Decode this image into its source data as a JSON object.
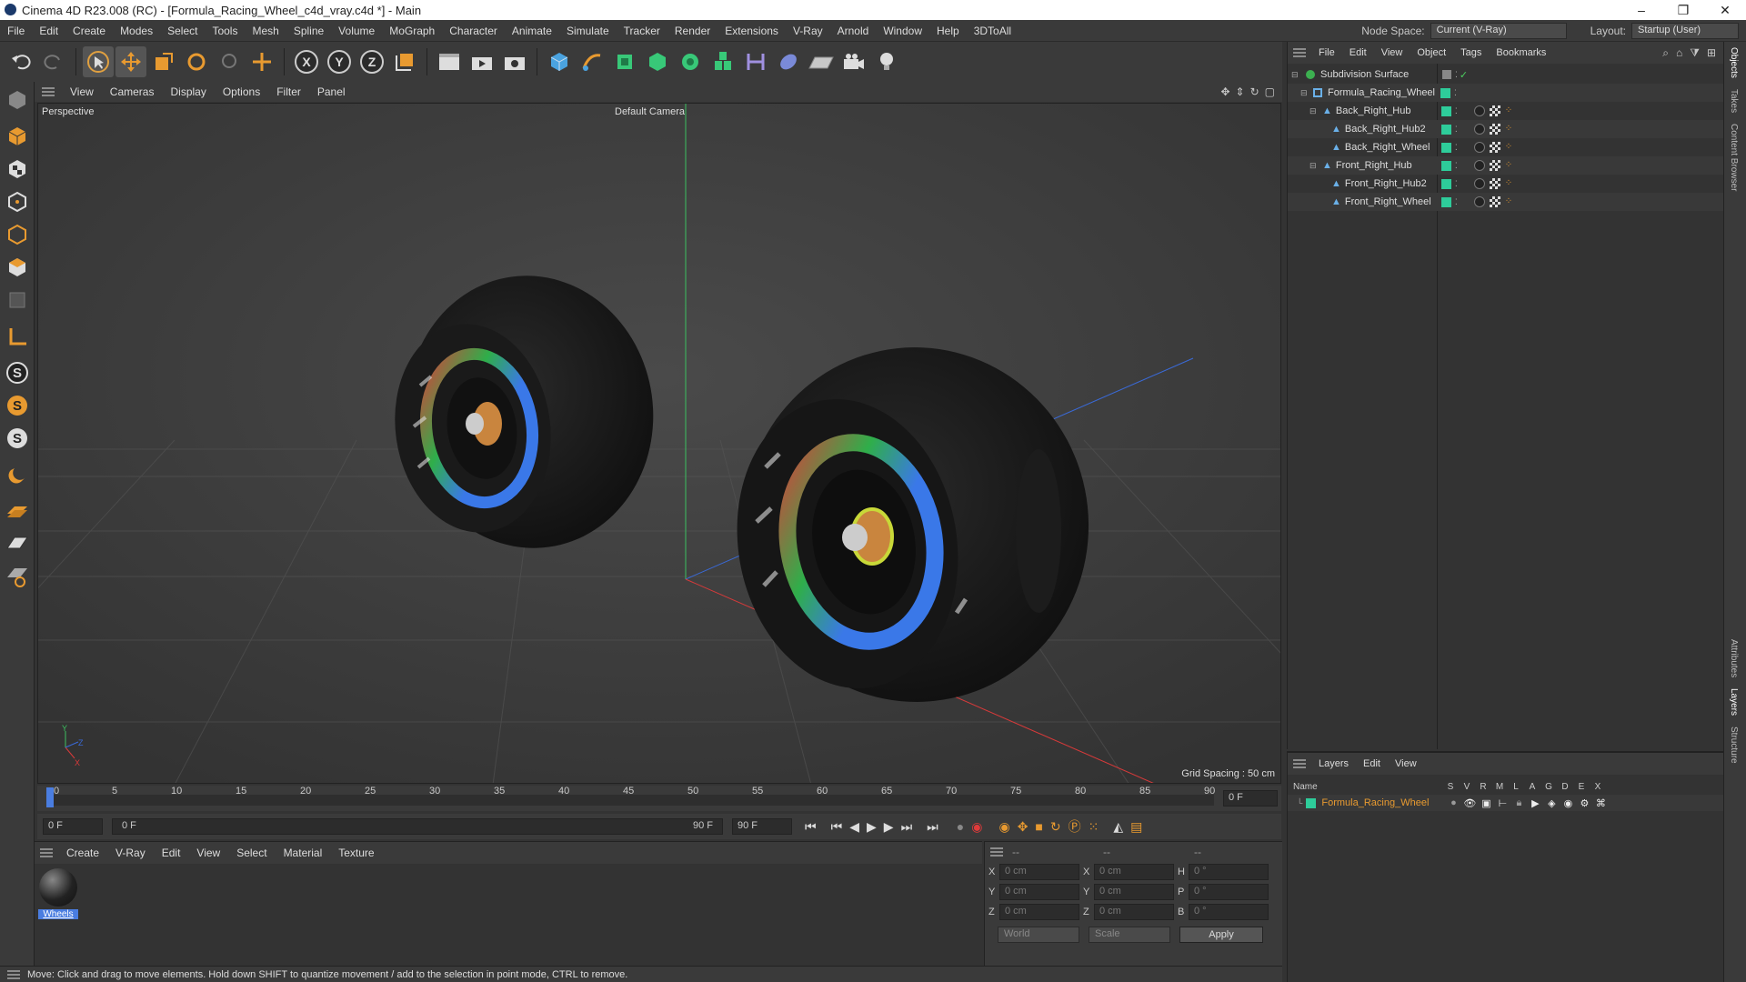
{
  "window": {
    "title": "Cinema 4D R23.008 (RC) - [Formula_Racing_Wheel_c4d_vray.c4d *] - Main",
    "min": "–",
    "max": "❐",
    "close": "✕"
  },
  "menu": [
    "File",
    "Edit",
    "Create",
    "Modes",
    "Select",
    "Tools",
    "Mesh",
    "Spline",
    "Volume",
    "MoGraph",
    "Character",
    "Animate",
    "Simulate",
    "Tracker",
    "Render",
    "Extensions",
    "V-Ray",
    "Arnold",
    "Window",
    "Help",
    "3DToAll"
  ],
  "nodespace": {
    "label": "Node Space:",
    "value": "Current (V-Ray)"
  },
  "layout": {
    "label": "Layout:",
    "value": "Startup (User)"
  },
  "viewport": {
    "menu": [
      "View",
      "Cameras",
      "Display",
      "Options",
      "Filter",
      "Panel"
    ],
    "label": "Perspective",
    "camera": "Default Camera",
    "grid": "Grid Spacing : 50 cm"
  },
  "timeline": {
    "ticks": [
      "0",
      "5",
      "10",
      "15",
      "20",
      "25",
      "30",
      "35",
      "40",
      "45",
      "50",
      "55",
      "60",
      "65",
      "70",
      "75",
      "80",
      "85",
      "90"
    ],
    "end_field": "0 F"
  },
  "transport": {
    "start": "0 F",
    "current": "0 F",
    "range_end": "90 F",
    "end": "90 F"
  },
  "material": {
    "menu": [
      "Create",
      "V-Ray",
      "Edit",
      "View",
      "Select",
      "Material",
      "Texture"
    ],
    "items": [
      {
        "name": "Wheels"
      }
    ]
  },
  "coords": {
    "headers": [
      "--",
      "--",
      "--"
    ],
    "rows": [
      {
        "a": "X",
        "av": "0 cm",
        "b": "X",
        "bv": "0 cm",
        "c": "H",
        "cv": "0 °"
      },
      {
        "a": "Y",
        "av": "0 cm",
        "b": "Y",
        "bv": "0 cm",
        "c": "P",
        "cv": "0 °"
      },
      {
        "a": "Z",
        "av": "0 cm",
        "b": "Z",
        "bv": "0 cm",
        "c": "B",
        "cv": "0 °"
      }
    ],
    "world": "World",
    "scale": "Scale",
    "apply": "Apply"
  },
  "status": "Move: Click and drag to move elements. Hold down SHIFT to quantize movement / add to the selection in point mode, CTRL to remove.",
  "objects": {
    "menu": [
      "File",
      "Edit",
      "View",
      "Object",
      "Tags",
      "Bookmarks"
    ],
    "items": [
      {
        "name": "Subdivision Surface",
        "level": 0,
        "type": "subd"
      },
      {
        "name": "Formula_Racing_Wheel",
        "level": 1,
        "type": "null"
      },
      {
        "name": "Back_Right_Hub",
        "level": 2,
        "type": "bone"
      },
      {
        "name": "Back_Right_Hub2",
        "level": 3,
        "type": "bone"
      },
      {
        "name": "Back_Right_Wheel",
        "level": 3,
        "type": "bone"
      },
      {
        "name": "Front_Right_Hub",
        "level": 2,
        "type": "bone"
      },
      {
        "name": "Front_Right_Hub2",
        "level": 3,
        "type": "bone"
      },
      {
        "name": "Front_Right_Wheel",
        "level": 3,
        "type": "bone"
      }
    ]
  },
  "layers": {
    "menu": [
      "Layers",
      "Edit",
      "View"
    ],
    "name_header": "Name",
    "cols": [
      "S",
      "V",
      "R",
      "M",
      "L",
      "A",
      "G",
      "D",
      "E",
      "X"
    ],
    "items": [
      {
        "name": "Formula_Racing_Wheel"
      }
    ]
  },
  "side_tabs": [
    "Objects",
    "Takes",
    "Content Browser",
    "Attributes",
    "Layers",
    "Structure"
  ]
}
